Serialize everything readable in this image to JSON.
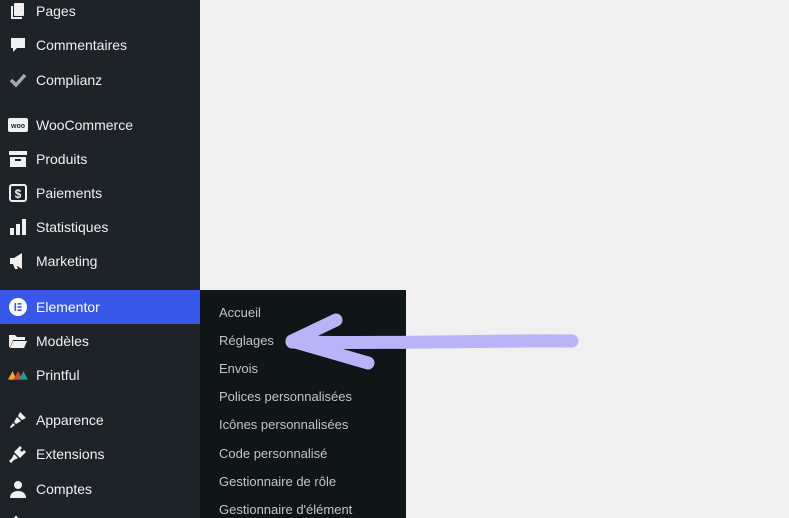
{
  "sidebar": {
    "items": [
      {
        "label": "Pages",
        "icon": "pages-icon"
      },
      {
        "label": "Commentaires",
        "icon": "comment-icon"
      },
      {
        "label": "Complianz",
        "icon": "checkmark-icon"
      },
      {
        "label": "WooCommerce",
        "icon": "woocommerce-icon",
        "badge": "woo"
      },
      {
        "label": "Produits",
        "icon": "archive-box-icon"
      },
      {
        "label": "Paiements",
        "icon": "dollar-icon",
        "badge": "$"
      },
      {
        "label": "Statistiques",
        "icon": "bar-chart-icon"
      },
      {
        "label": "Marketing",
        "icon": "megaphone-icon"
      },
      {
        "label": "Elementor",
        "icon": "elementor-icon",
        "badge": "E"
      },
      {
        "label": "Modèles",
        "icon": "folder-open-icon"
      },
      {
        "label": "Printful",
        "icon": "printful-icon"
      },
      {
        "label": "Apparence",
        "icon": "paintbrush-icon"
      },
      {
        "label": "Extensions",
        "icon": "plugin-icon"
      },
      {
        "label": "Comptes",
        "icon": "user-icon"
      }
    ]
  },
  "submenu": {
    "items": [
      "Accueil",
      "Réglages",
      "Envois",
      "Polices personnalisées",
      "Icônes personnalisées",
      "Code personnalisé",
      "Gestionnaire de rôle",
      "Gestionnaire d'élément"
    ]
  },
  "annotation": {
    "color": "#b9b4f8",
    "target": "Réglages"
  },
  "colors": {
    "sidebar_bg": "#1d2327",
    "active_bg": "#3858e9",
    "flyout_bg": "#101517",
    "content_bg": "#f0f0f1"
  }
}
